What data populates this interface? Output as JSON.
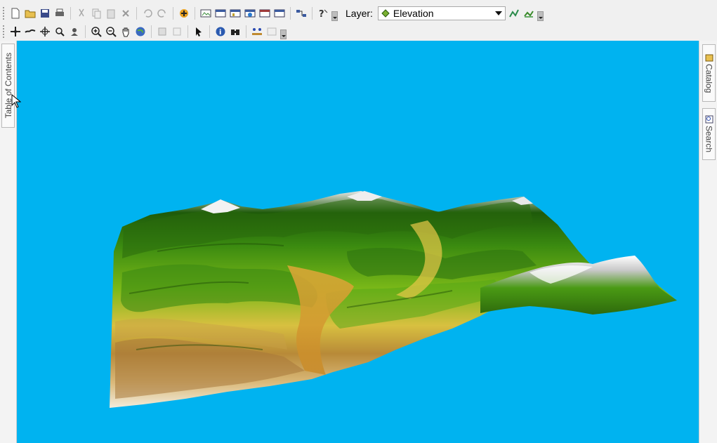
{
  "toolbar": {
    "layer_label": "Layer:",
    "layer_value": "Elevation",
    "row1_icons": [
      "new-document-icon",
      "open-folder-icon",
      "save-icon",
      "print-icon",
      "cut-icon",
      "copy-icon",
      "paste-icon",
      "delete-icon",
      "undo-icon",
      "redo-icon",
      "add-data-icon",
      "layout-icon",
      "table-icon",
      "chart-icon",
      "globe-window-icon",
      "window-icon",
      "connect-icon",
      "help-icon"
    ],
    "row2_icons": [
      "navigate-icon",
      "fly-icon",
      "center-icon",
      "zoom-to-target-icon",
      "set-observer-icon",
      "zoom-in-icon",
      "zoom-out-icon",
      "pan-icon",
      "full-extent-icon",
      "select-features-icon",
      "clear-selection-icon",
      "select-elements-icon",
      "identify-icon",
      "find-icon",
      "measure-icon",
      "options-icon"
    ]
  },
  "side_panels": {
    "toc_label": "Table of Contents",
    "catalog_label": "Catalog",
    "search_label": "Search"
  },
  "colors": {
    "map_background": "#00b3f0",
    "terrain_low": "#e8e0c8",
    "terrain_mid": "#c8a040",
    "terrain_green": "#5aa010",
    "terrain_dark": "#1e5a0a",
    "terrain_snow": "#f4f4f4"
  }
}
